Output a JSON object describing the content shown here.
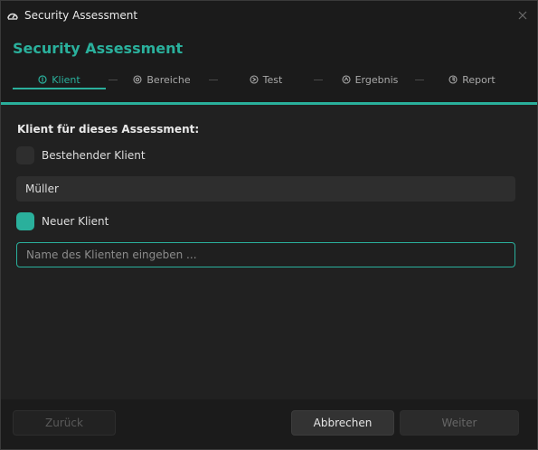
{
  "window": {
    "title": "Security Assessment"
  },
  "header": {
    "heading": "Security Assessment"
  },
  "steps": [
    {
      "label": "Klient",
      "icon": "shield-icon",
      "active": true
    },
    {
      "label": "Bereiche",
      "icon": "target-icon",
      "active": false
    },
    {
      "label": "Test",
      "icon": "test-icon",
      "active": false
    },
    {
      "label": "Ergebnis",
      "icon": "result-icon",
      "active": false
    },
    {
      "label": "Report",
      "icon": "report-icon",
      "active": false
    }
  ],
  "content": {
    "section_label": "Klient für dieses Assessment:",
    "existing_option": {
      "label": "Bestehender Klient",
      "checked": false
    },
    "existing_client_value": "Müller",
    "new_option": {
      "label": "Neuer Klient",
      "checked": true
    },
    "new_client_input": {
      "value": "",
      "placeholder": "Name des Klienten eingeben ..."
    }
  },
  "footer": {
    "back_label": "Zurück",
    "cancel_label": "Abbrechen",
    "next_label": "Weiter"
  },
  "colors": {
    "accent": "#2ab09c",
    "background": "#212121",
    "titlebar": "#1b1b1b"
  }
}
